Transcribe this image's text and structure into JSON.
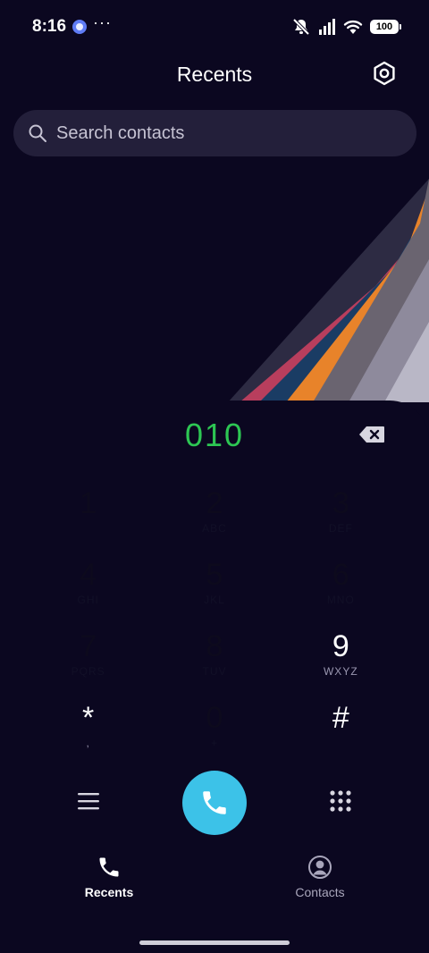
{
  "status_bar": {
    "time": "8:16",
    "more": "···",
    "battery": "100",
    "icons": [
      "app-notification-icon",
      "mute-icon",
      "signal-icon",
      "wifi-icon",
      "battery-icon"
    ]
  },
  "header": {
    "title": "Recents",
    "settings_icon": "settings-hexagon-icon"
  },
  "search": {
    "placeholder": "Search contacts",
    "value": ""
  },
  "dialer": {
    "dialed_number": "010",
    "backspace_icon": "backspace-icon",
    "keys": [
      {
        "digit": "1",
        "letters": ""
      },
      {
        "digit": "2",
        "letters": "ABC"
      },
      {
        "digit": "3",
        "letters": "DEF"
      },
      {
        "digit": "4",
        "letters": "GHI"
      },
      {
        "digit": "5",
        "letters": "JKL"
      },
      {
        "digit": "6",
        "letters": "MNO"
      },
      {
        "digit": "7",
        "letters": "PQRS"
      },
      {
        "digit": "8",
        "letters": "TUV"
      },
      {
        "digit": "9",
        "letters": "WXYZ"
      },
      {
        "digit": "*",
        "letters": ","
      },
      {
        "digit": "0",
        "letters": "+"
      },
      {
        "digit": "#",
        "letters": ""
      }
    ]
  },
  "actions": {
    "menu_icon": "menu-icon",
    "call_icon": "phone-icon",
    "dialpad_icon": "dialpad-icon",
    "call_color": "#3cc2e8"
  },
  "tabs": [
    {
      "label": "Recents",
      "icon": "phone-icon",
      "active": true
    },
    {
      "label": "Contacts",
      "icon": "contact-icon",
      "active": false
    }
  ],
  "colors": {
    "background": "#0b0720",
    "dialed_number": "#2dc653",
    "search_background": "#231f3a"
  }
}
